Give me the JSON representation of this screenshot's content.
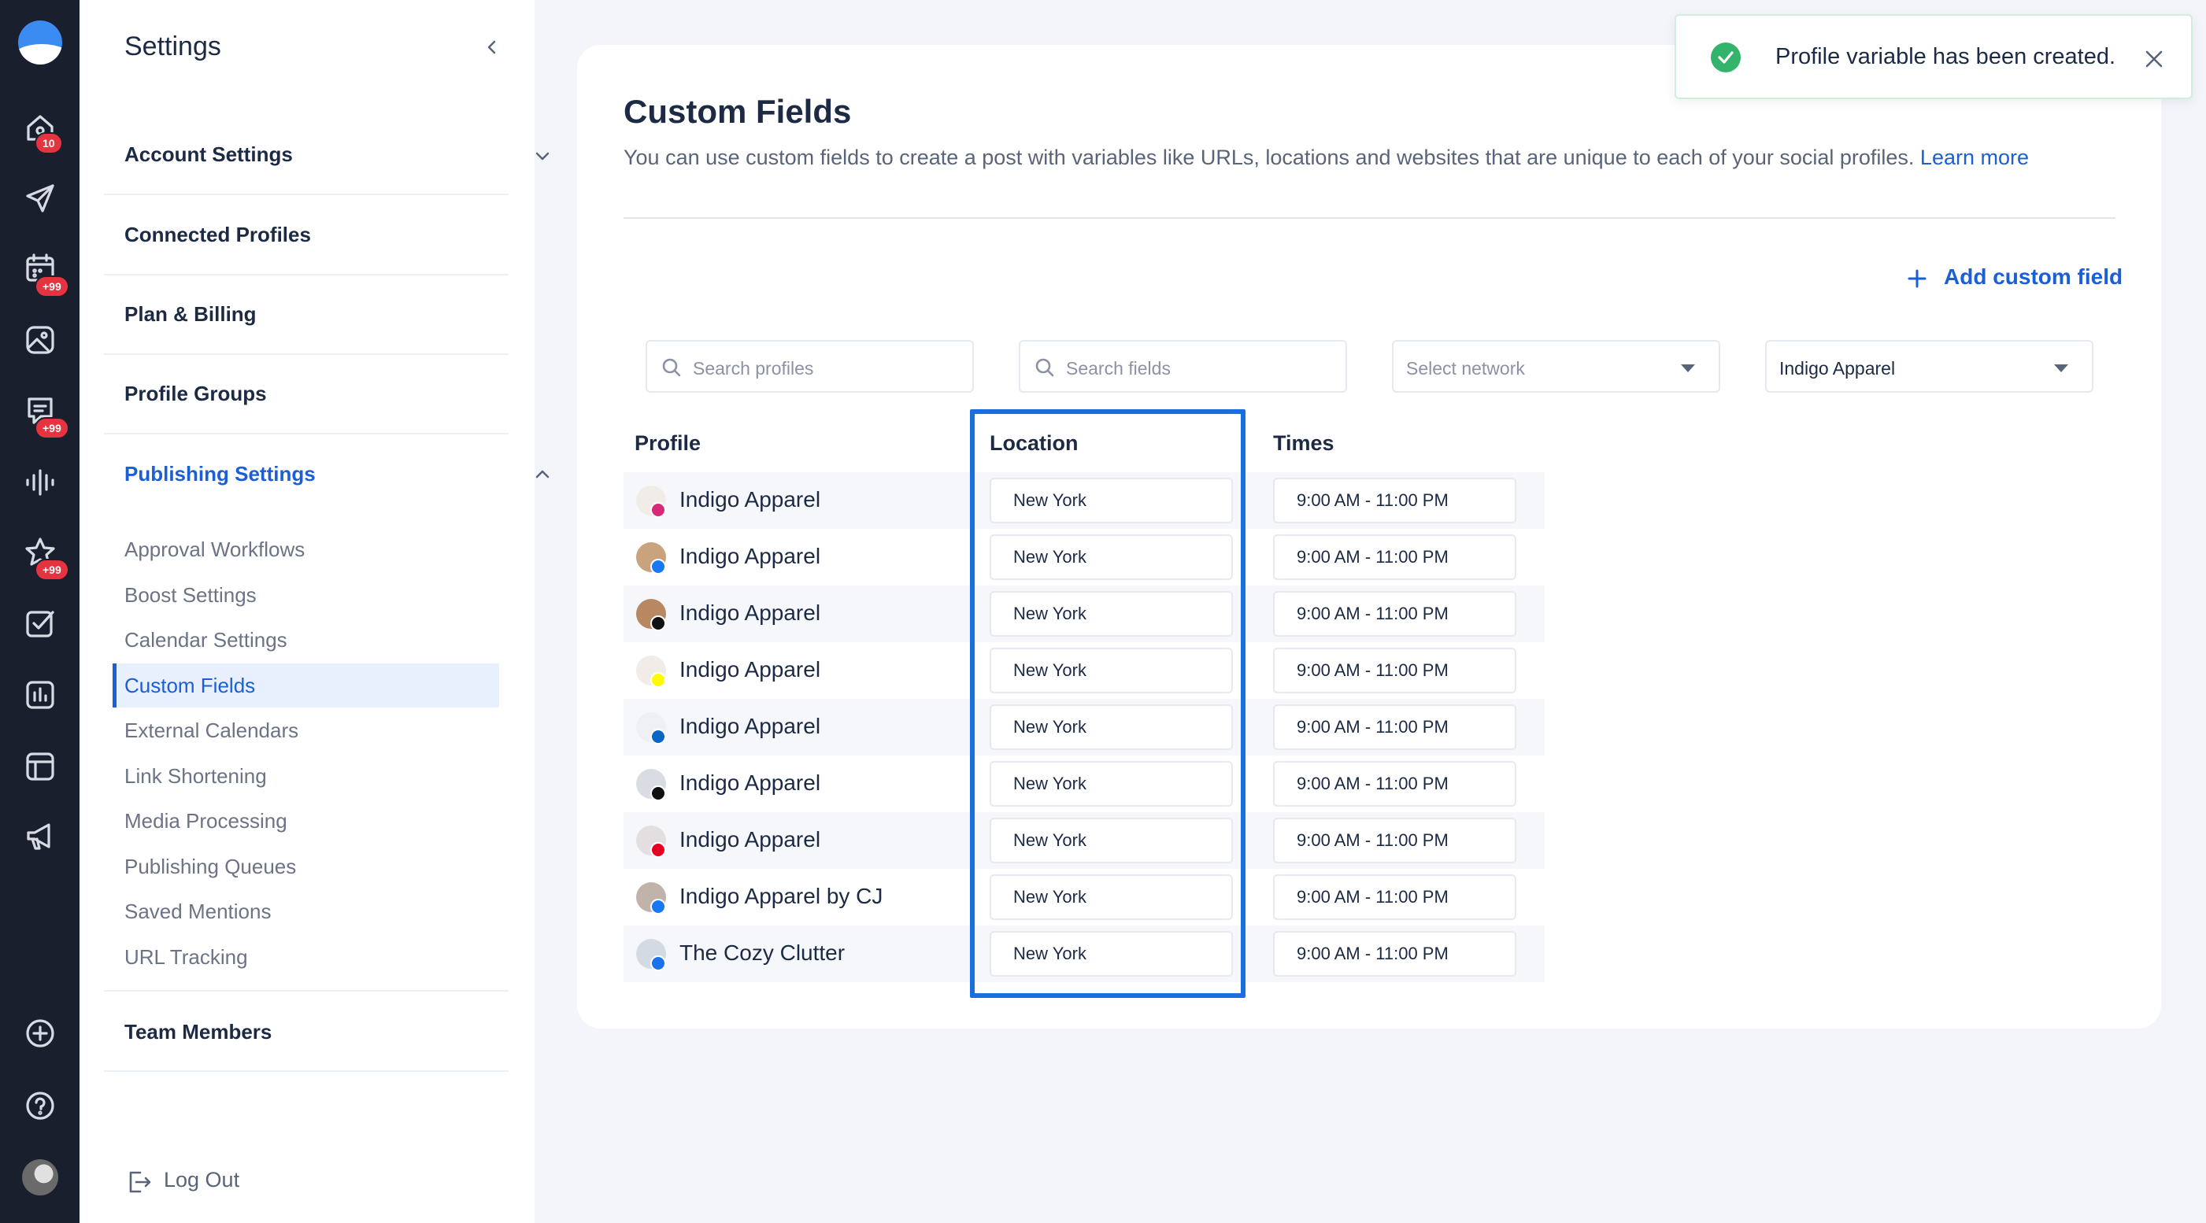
{
  "rail": {
    "badges": {
      "home": "10",
      "calendar": "+99",
      "inbox": "+99",
      "reviews": "+99"
    },
    "icons": [
      "home-icon",
      "send-icon",
      "calendar-icon",
      "media-icon",
      "inbox-icon",
      "listening-icon",
      "reviews-icon",
      "tasks-icon",
      "analytics-icon",
      "layout-icon",
      "campaign-icon",
      "add-icon",
      "help-icon"
    ]
  },
  "sidebar": {
    "title": "Settings",
    "sections": {
      "account": "Account Settings",
      "connected": "Connected Profiles",
      "billing": "Plan & Billing",
      "groups": "Profile Groups",
      "publishing": "Publishing Settings",
      "team": "Team Members"
    },
    "publishing_items": [
      "Approval Workflows",
      "Boost Settings",
      "Calendar Settings",
      "Custom Fields",
      "External Calendars",
      "Link Shortening",
      "Media Processing",
      "Publishing Queues",
      "Saved Mentions",
      "URL Tracking"
    ],
    "logout": "Log Out"
  },
  "main": {
    "title": "Custom Fields",
    "description": "You can use custom fields to create a post with variables like URLs, locations and websites that are unique to each of your social profiles.",
    "learn_more": "Learn more",
    "add_button": "Add custom field",
    "filters": {
      "search_profiles": "Search profiles",
      "search_fields": "Search fields",
      "network_placeholder": "Select network",
      "selected_group": "Indigo Apparel"
    },
    "columns": {
      "profile": "Profile",
      "location": "Location",
      "times": "Times"
    },
    "rows": [
      {
        "name": "Indigo Apparel",
        "network": "instagram",
        "location": "New York",
        "times": "9:00 AM - 11:00 PM"
      },
      {
        "name": "Indigo Apparel",
        "network": "facebook",
        "location": "New York",
        "times": "9:00 AM - 11:00 PM"
      },
      {
        "name": "Indigo Apparel",
        "network": "tiktok",
        "location": "New York",
        "times": "9:00 AM - 11:00 PM"
      },
      {
        "name": "Indigo Apparel",
        "network": "snapchat",
        "location": "New York",
        "times": "9:00 AM - 11:00 PM"
      },
      {
        "name": "Indigo Apparel",
        "network": "linkedin",
        "location": "New York",
        "times": "9:00 AM - 11:00 PM"
      },
      {
        "name": "Indigo Apparel",
        "network": "threads",
        "location": "New York",
        "times": "9:00 AM - 11:00 PM"
      },
      {
        "name": "Indigo Apparel",
        "network": "pinterest",
        "location": "New York",
        "times": "9:00 AM - 11:00 PM"
      },
      {
        "name": "Indigo Apparel by CJ",
        "network": "facebook",
        "location": "New York",
        "times": "9:00 AM - 11:00 PM"
      },
      {
        "name": "The Cozy Clutter",
        "network": "google-business",
        "location": "New York",
        "times": "9:00 AM - 11:00 PM"
      }
    ]
  },
  "toast": {
    "message": "Profile variable has been created."
  },
  "colors": {
    "accent": "#1a5fd6",
    "rail": "#1a1f2e",
    "success": "#34b36b",
    "badge": "#e5343f",
    "highlight": "#1a6fe0"
  }
}
